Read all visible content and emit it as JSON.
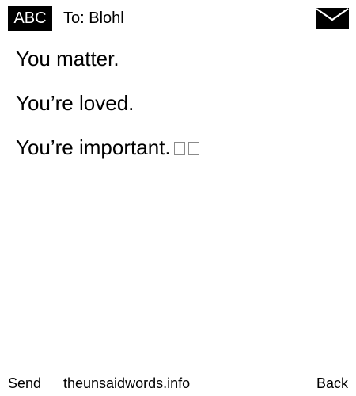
{
  "header": {
    "input_mode": "ABC",
    "recipient": "To: Blohl",
    "envelope_icon": "envelope-icon"
  },
  "message": {
    "lines": [
      "You matter.",
      "You’re loved.",
      "You’re important."
    ],
    "trailing_glyphs": "two unrendered emoji placeholders"
  },
  "footer": {
    "left_softkey": "Send",
    "site": "theunsaidwords.info",
    "right_softkey": "Back"
  }
}
